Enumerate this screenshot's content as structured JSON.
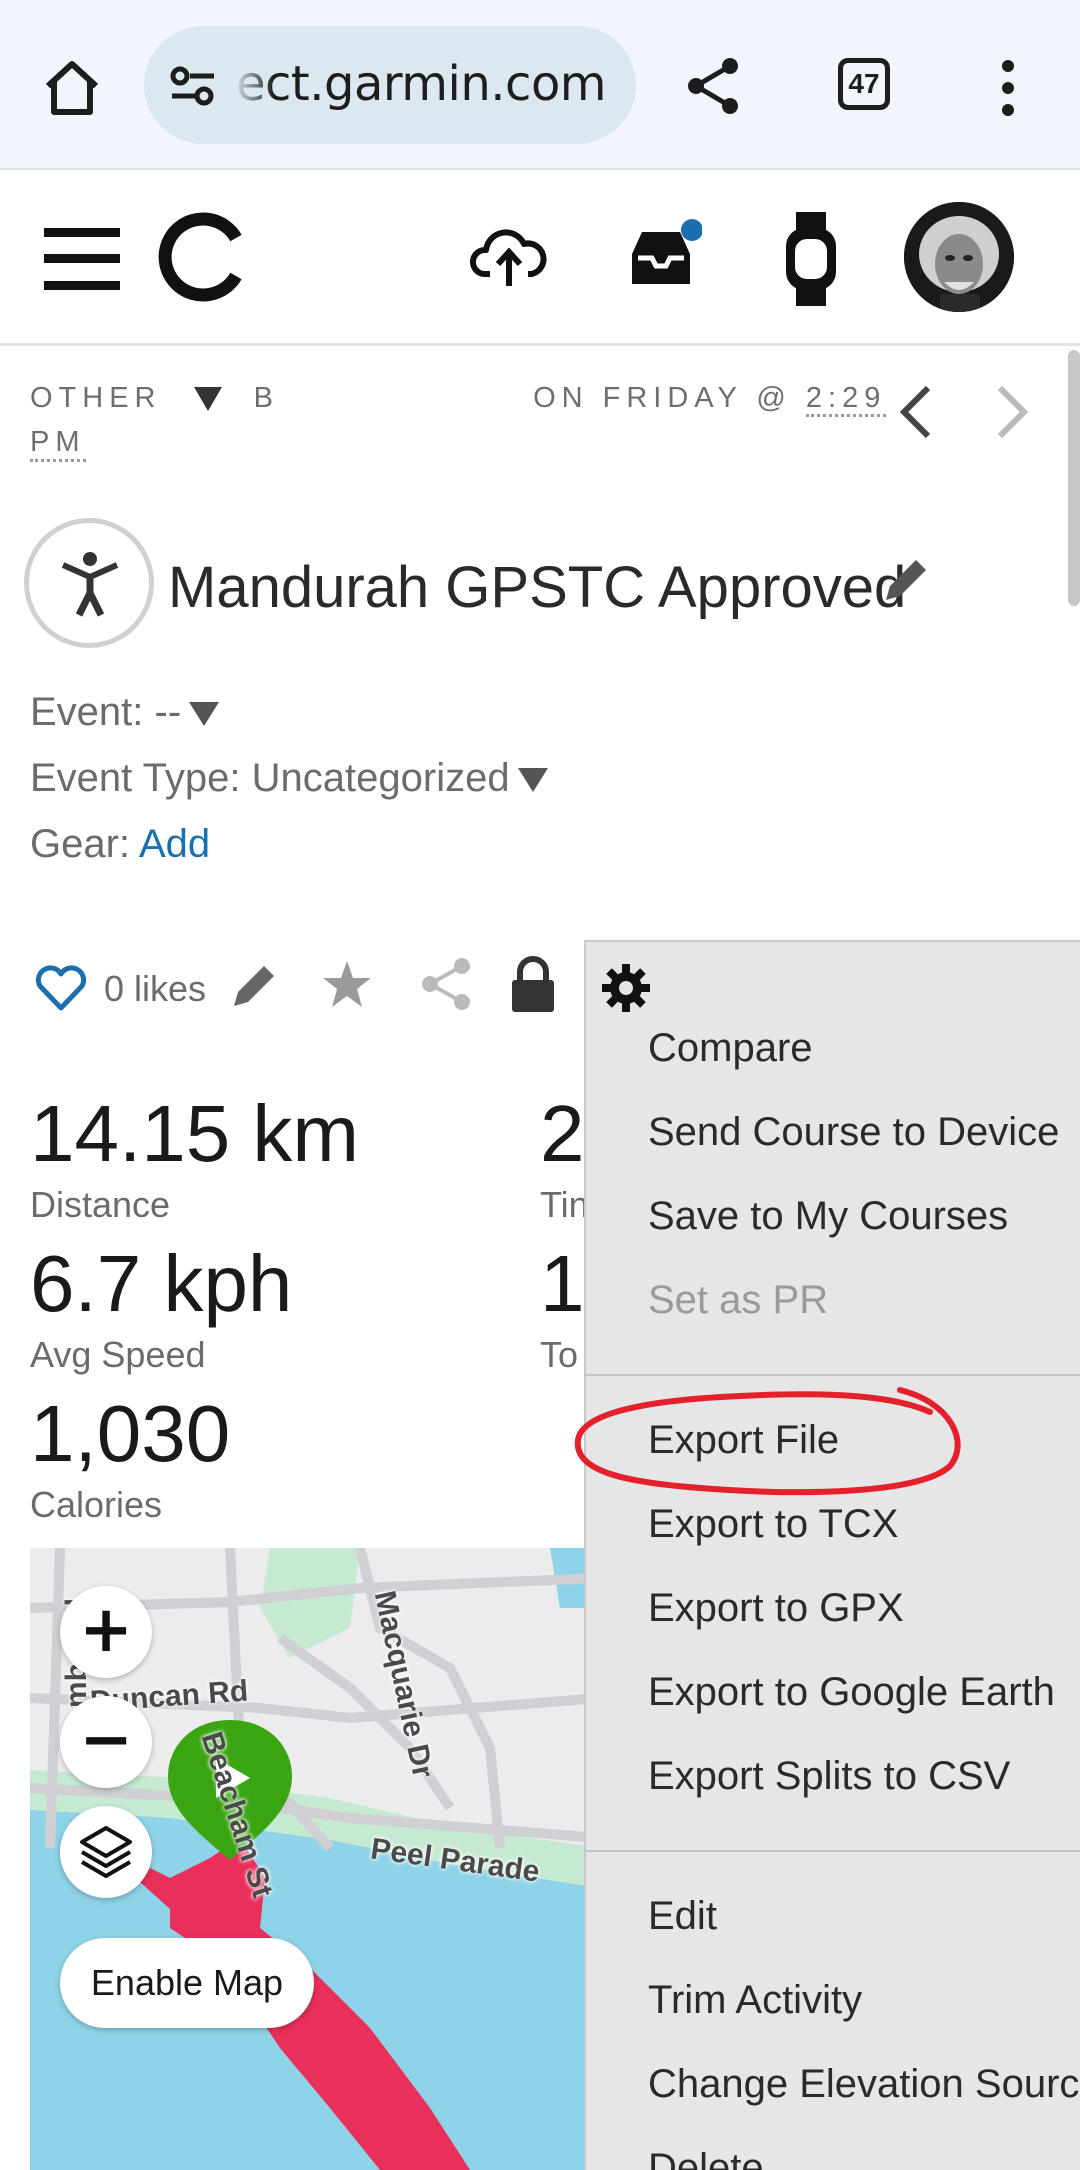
{
  "browser": {
    "url": "ect.garmin.com",
    "tab_count": "47"
  },
  "activity": {
    "breadcrumb_line1": "OTHER",
    "breadcrumb_by": "B",
    "breadcrumb_on": "ON FRIDAY @",
    "breadcrumb_time": "2:29",
    "breadcrumb_line2": "PM",
    "title": "Mandurah GPSTC Approved",
    "event_label": "Event:",
    "event_value": "--",
    "event_type_label": "Event Type:",
    "event_type_value": "Uncategorized",
    "gear_label": "Gear:",
    "gear_link": "Add",
    "likes": "0 likes"
  },
  "stats": [
    {
      "value": "14.15 km",
      "label": "Distance"
    },
    {
      "value": "6.7 kph",
      "label": "Avg Speed"
    },
    {
      "value": "1,030",
      "label": "Calories"
    }
  ],
  "stats_right": [
    {
      "value": "2",
      "label": "Tin"
    },
    {
      "value": "1",
      "label": "To"
    }
  ],
  "map": {
    "zoom_in": "+",
    "zoom_out": "−",
    "enable_map": "Enable Map",
    "roads": {
      "wamba": "Wamba Rd",
      "duncan": "Duncan Rd",
      "beacham": "Beacham St",
      "macquarie": "Macquarie Dr",
      "peel": "Peel Parade"
    }
  },
  "menu": {
    "group1": [
      "Compare",
      "Send Course to Device",
      "Save to My Courses"
    ],
    "disabled": "Set as PR",
    "group2": [
      "Export File",
      "Export to TCX",
      "Export to GPX",
      "Export to Google Earth",
      "Export Splits to CSV"
    ],
    "group3": [
      "Edit",
      "Trim Activity",
      "Change Elevation Sources",
      "Delete"
    ]
  },
  "colors": {
    "accent_blue": "#1c6fae",
    "track_red": "#e8305a",
    "marker_green": "#3aa512",
    "annotation_red": "#e3202b",
    "water": "#8fd3e8",
    "park": "#c6ead1"
  }
}
